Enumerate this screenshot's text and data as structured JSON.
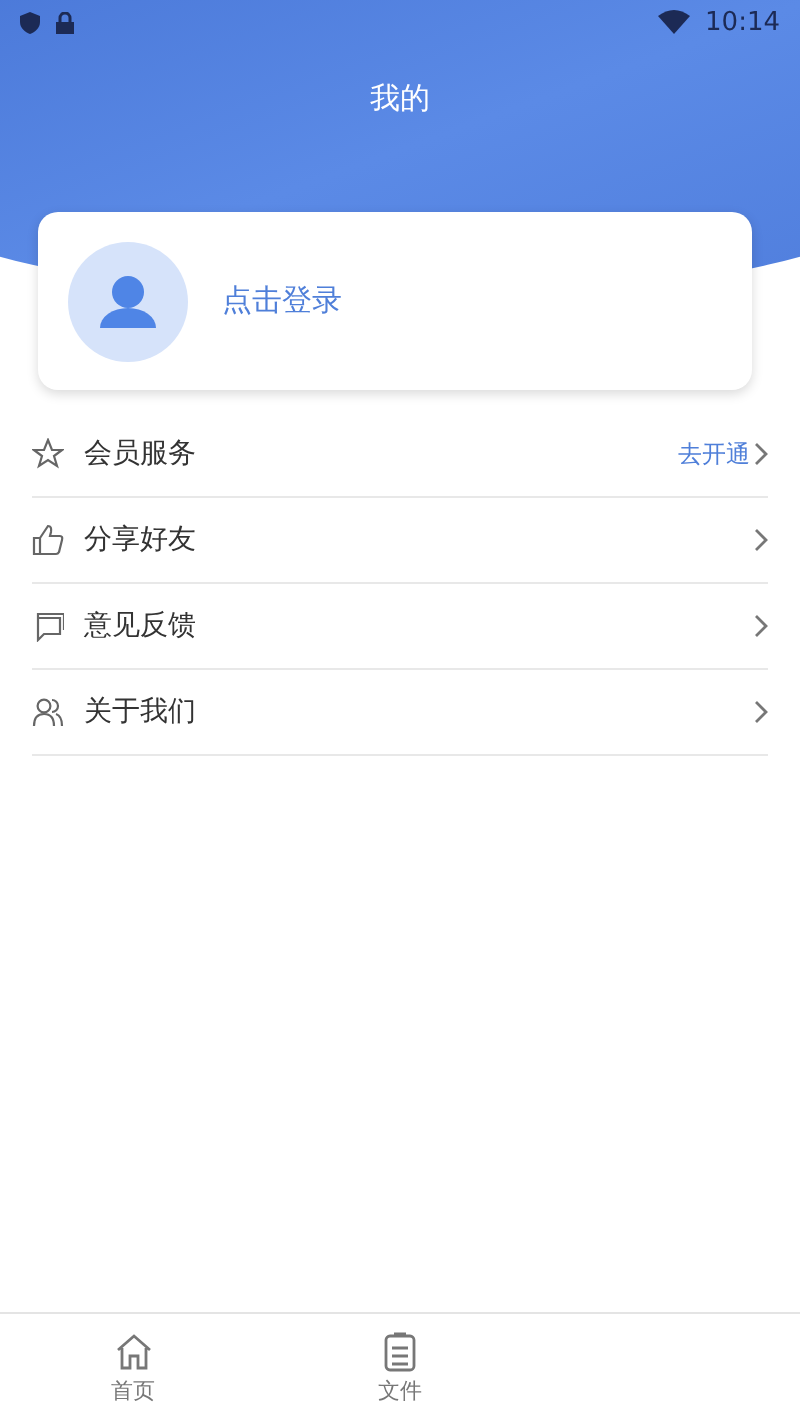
{
  "status_bar": {
    "time": "10:14"
  },
  "header": {
    "title": "我的"
  },
  "login_card": {
    "label": "点击登录"
  },
  "menu": [
    {
      "kind": "star",
      "label": "会员服务",
      "action": "去开通"
    },
    {
      "kind": "thumb",
      "label": "分享好友"
    },
    {
      "kind": "chat",
      "label": "意见反馈"
    },
    {
      "kind": "people",
      "label": "关于我们"
    }
  ],
  "bottom_nav": [
    {
      "kind": "home",
      "label": "首页",
      "selected": false
    },
    {
      "kind": "file",
      "label": "文件",
      "selected": false
    }
  ]
}
